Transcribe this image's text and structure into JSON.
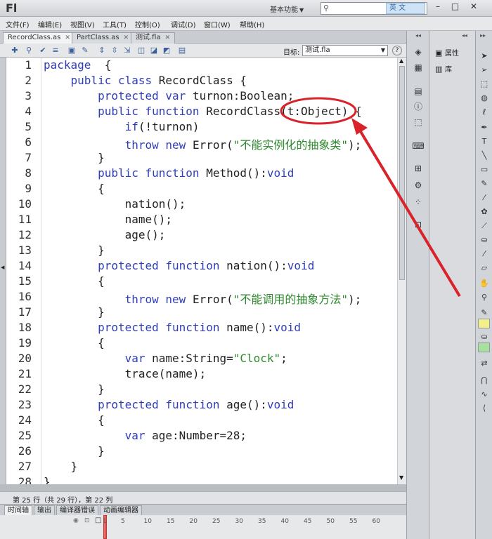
{
  "app": {
    "logo": "Fl",
    "workspace": "基本功能",
    "ime": "英 文",
    "window_buttons": "– □ ✕"
  },
  "menu": [
    "文件(F)",
    "编辑(E)",
    "视图(V)",
    "工具(T)",
    "控制(O)",
    "调试(D)",
    "窗口(W)",
    "帮助(H)"
  ],
  "tabs": [
    {
      "label": "RecordClass.as",
      "active": true
    },
    {
      "label": "PartClass.as",
      "active": false
    },
    {
      "label": "测试.fla",
      "active": false
    }
  ],
  "toolbar": {
    "target_label": "目标:",
    "target_value": "测试.fla",
    "help": "?"
  },
  "code_lines": [
    "package  {",
    "    public class RecordClass {",
    "        protected var turnon:Boolean;",
    "        public function RecordClass(t:Object) {",
    "            if(!turnon)",
    "            throw new Error(\"不能实例化的抽象类\");",
    "        }",
    "        public function Method():void",
    "        {",
    "            nation();",
    "            name();",
    "            age();",
    "        }",
    "        protected function nation():void",
    "        {",
    "            throw new Error(\"不能调用的抽象方法\");",
    "        }",
    "        protected function name():void",
    "        {",
    "            var name:String=\"Clock\";",
    "            trace(name);",
    "        }",
    "        protected function age():void",
    "        {",
    "            var age:Number=28;",
    "        }",
    "    }",
    "}"
  ],
  "line_numbers": [
    "1",
    "2",
    "3",
    "4",
    "5",
    "6",
    "7",
    "8",
    "9",
    "10",
    "11",
    "12",
    "13",
    "14",
    "15",
    "16",
    "17",
    "18",
    "19",
    "20",
    "21",
    "22",
    "23",
    "24",
    "25",
    "26",
    "27",
    "28"
  ],
  "status": "第 25 行（共 29 行），第 22 列",
  "bottom_tabs": [
    "时间轴",
    "输出",
    "编译器错误",
    "动画编辑器"
  ],
  "frame_numbers": [
    "1",
    "5",
    "10",
    "15",
    "20",
    "25",
    "30",
    "35",
    "40",
    "45",
    "50",
    "55",
    "60"
  ],
  "panels": {
    "properties": "属性",
    "library": "库"
  },
  "colors": {
    "keyword": "#2f3eb8",
    "string": "#2e8a2e",
    "highlight": "#d9232a"
  },
  "annotation": {
    "type": "ellipse-with-arrow",
    "target": "t:Object"
  }
}
